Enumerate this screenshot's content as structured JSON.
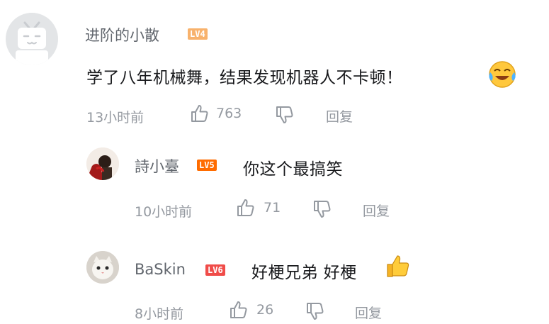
{
  "comment": {
    "user": "进阶的小散",
    "level": "LV4",
    "level_color": "#f8b26c",
    "text": "学了八年机械舞，结果发现机器人不卡顿！",
    "emoji": "laughing-cry-emoji",
    "time": "13小时前",
    "likes": "763",
    "reply_label": "回复"
  },
  "replies": [
    {
      "user": "詩小臺",
      "level": "LV5",
      "level_color": "#ff6c00",
      "text": "你这个最搞笑",
      "time": "10小时前",
      "likes": "71",
      "reply_label": "回复"
    },
    {
      "user": "BaSkin",
      "level": "LV6",
      "level_color": "#f04c49",
      "text": "好梗兄弟 好梗",
      "emoji": "thumbs-up-emoji",
      "time": "8小时前",
      "likes": "26",
      "reply_label": "回复"
    }
  ]
}
